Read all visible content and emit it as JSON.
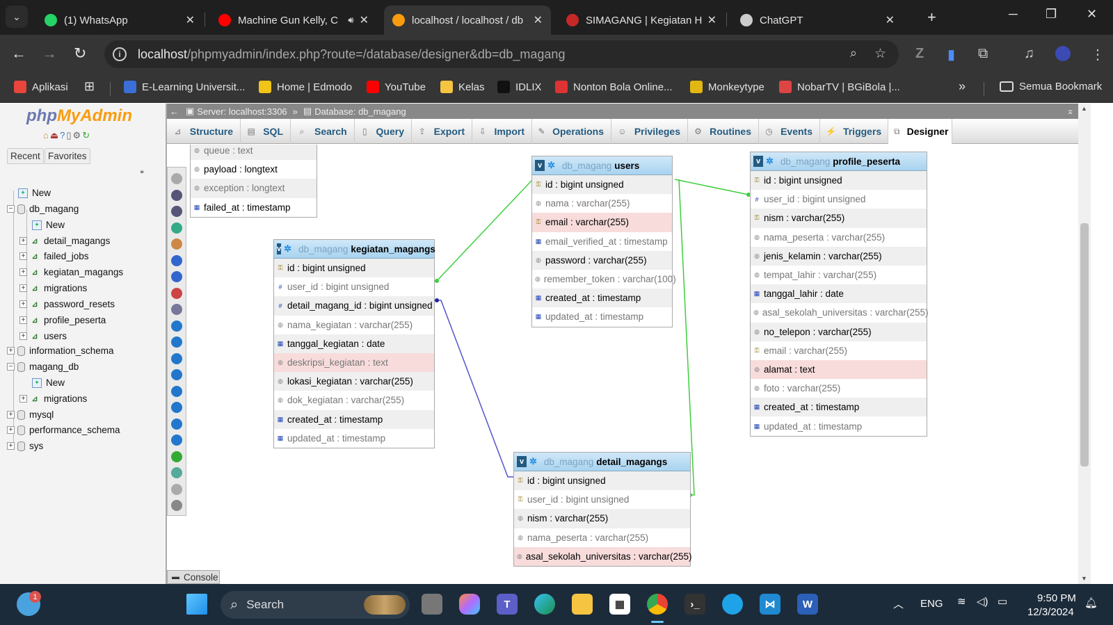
{
  "browser": {
    "tabs": [
      {
        "title": "(1) WhatsApp",
        "icon": "whatsapp-icon",
        "color": "#25d366"
      },
      {
        "title": "Machine Gun Kelly, C",
        "icon": "youtube-icon",
        "color": "#ff0000"
      },
      {
        "title": "localhost / localhost / db",
        "icon": "phpmyadmin-icon",
        "color": "#f89c0e"
      },
      {
        "title": "SIMAGANG | Kegiatan Ha",
        "icon": "shield-icon",
        "color": "#c62828"
      },
      {
        "title": "ChatGPT",
        "icon": "chatgpt-icon",
        "color": "#cccccc"
      }
    ],
    "url_host": "localhost",
    "url_path": "/phpmyadmin/index.php?route=/database/designer&db=db_magang",
    "bookmarks": [
      {
        "label": "Aplikasi",
        "icon": "apps-grid-icon"
      },
      {
        "label": "E-Learning Universit...",
        "icon": "university-icon"
      },
      {
        "label": "Home | Edmodo",
        "icon": "edmodo-icon"
      },
      {
        "label": "YouTube",
        "icon": "youtube-icon"
      },
      {
        "label": "Kelas",
        "icon": "classroom-icon"
      },
      {
        "label": "IDLIX",
        "icon": "idlix-icon"
      },
      {
        "label": "Nonton Bola Online...",
        "icon": "ball-icon"
      },
      {
        "label": "Monkeytype",
        "icon": "monkeytype-icon"
      },
      {
        "label": "NobarTV | BGiBola |...",
        "icon": "nobartv-icon"
      }
    ],
    "all_bookmarks": "Semua Bookmark",
    "overflow": "»"
  },
  "pma": {
    "logo_php": "php",
    "logo_admin": "MyAdmin",
    "left_tabs": [
      "Recent",
      "Favorites"
    ],
    "tree": [
      {
        "label": "New",
        "kind": "new"
      },
      {
        "label": "db_magang",
        "kind": "db",
        "exp": "−"
      },
      {
        "label": "New",
        "kind": "new"
      },
      {
        "label": "detail_magangs",
        "kind": "tbl"
      },
      {
        "label": "failed_jobs",
        "kind": "tbl"
      },
      {
        "label": "kegiatan_magangs",
        "kind": "tbl"
      },
      {
        "label": "migrations",
        "kind": "tbl"
      },
      {
        "label": "password_resets",
        "kind": "tbl"
      },
      {
        "label": "profile_peserta",
        "kind": "tbl"
      },
      {
        "label": "users",
        "kind": "tbl"
      },
      {
        "label": "information_schema",
        "kind": "db",
        "exp": "+"
      },
      {
        "label": "magang_db",
        "kind": "db",
        "exp": "−"
      },
      {
        "label": "New",
        "kind": "new"
      },
      {
        "label": "migrations",
        "kind": "tbl"
      },
      {
        "label": "mysql",
        "kind": "db",
        "exp": "+"
      },
      {
        "label": "performance_schema",
        "kind": "db",
        "exp": "+"
      },
      {
        "label": "sys",
        "kind": "db",
        "exp": "+"
      }
    ],
    "breadcrumb_server": "Server: localhost:3306",
    "breadcrumb_db": "Database: db_magang",
    "menu": [
      "Structure",
      "SQL",
      "Search",
      "Query",
      "Export",
      "Import",
      "Operations",
      "Privileges",
      "Routines",
      "Events",
      "Triggers",
      "Designer"
    ],
    "active_menu": "Designer",
    "console": "Console"
  },
  "designer": {
    "failed_jobs_partial": [
      {
        "text": "queue : text",
        "nn": true
      },
      {
        "text": "payload : longtext",
        "nn": false
      },
      {
        "text": "exception : longtext",
        "nn": true
      },
      {
        "text": "failed_at : timestamp",
        "nn": false
      }
    ],
    "users": {
      "db": "db_magang",
      "name": "users",
      "cols": [
        {
          "text": "id : bigint unsigned",
          "nn": false,
          "k": "key"
        },
        {
          "text": "nama : varchar(255)",
          "nn": true,
          "k": "txt"
        },
        {
          "text": "email : varchar(255)",
          "nn": false,
          "k": "key",
          "hl": true
        },
        {
          "text": "email_verified_at : timestamp",
          "nn": true,
          "k": "dt"
        },
        {
          "text": "password : varchar(255)",
          "nn": false,
          "k": "txt"
        },
        {
          "text": "remember_token : varchar(100)",
          "nn": true,
          "k": "txt"
        },
        {
          "text": "created_at : timestamp",
          "nn": false,
          "k": "dt"
        },
        {
          "text": "updated_at : timestamp",
          "nn": true,
          "k": "dt"
        }
      ]
    },
    "kegiatan_magangs": {
      "db": "db_magang",
      "name": "kegiatan_magangs",
      "cols": [
        {
          "text": "id : bigint unsigned",
          "nn": false,
          "k": "key"
        },
        {
          "text": "user_id : bigint unsigned",
          "nn": true,
          "k": "num"
        },
        {
          "text": "detail_magang_id : bigint unsigned",
          "nn": false,
          "k": "num"
        },
        {
          "text": "nama_kegiatan : varchar(255)",
          "nn": true,
          "k": "txt"
        },
        {
          "text": "tanggal_kegiatan : date",
          "nn": false,
          "k": "dt"
        },
        {
          "text": "deskripsi_kegiatan : text",
          "nn": true,
          "k": "txt",
          "hl": true
        },
        {
          "text": "lokasi_kegiatan : varchar(255)",
          "nn": false,
          "k": "txt"
        },
        {
          "text": "dok_kegiatan : varchar(255)",
          "nn": true,
          "k": "txt"
        },
        {
          "text": "created_at : timestamp",
          "nn": false,
          "k": "dt"
        },
        {
          "text": "updated_at : timestamp",
          "nn": true,
          "k": "dt"
        }
      ]
    },
    "profile_peserta": {
      "db": "db_magang",
      "name": "profile_peserta",
      "cols": [
        {
          "text": "id : bigint unsigned",
          "nn": false,
          "k": "key"
        },
        {
          "text": "user_id : bigint unsigned",
          "nn": true,
          "k": "num"
        },
        {
          "text": "nism : varchar(255)",
          "nn": false,
          "k": "key"
        },
        {
          "text": "nama_peserta : varchar(255)",
          "nn": true,
          "k": "txt"
        },
        {
          "text": "jenis_kelamin : varchar(255)",
          "nn": false,
          "k": "txt"
        },
        {
          "text": "tempat_lahir : varchar(255)",
          "nn": true,
          "k": "txt"
        },
        {
          "text": "tanggal_lahir : date",
          "nn": false,
          "k": "dt"
        },
        {
          "text": "asal_sekolah_universitas : varchar(255)",
          "nn": true,
          "k": "txt"
        },
        {
          "text": "no_telepon : varchar(255)",
          "nn": false,
          "k": "txt"
        },
        {
          "text": "email : varchar(255)",
          "nn": true,
          "k": "key"
        },
        {
          "text": "alamat : text",
          "nn": false,
          "k": "txt",
          "hl": true
        },
        {
          "text": "foto : varchar(255)",
          "nn": true,
          "k": "txt"
        },
        {
          "text": "created_at : timestamp",
          "nn": false,
          "k": "dt"
        },
        {
          "text": "updated_at : timestamp",
          "nn": true,
          "k": "dt"
        }
      ]
    },
    "detail_magangs": {
      "db": "db_magang",
      "name": "detail_magangs",
      "cols": [
        {
          "text": "id : bigint unsigned",
          "nn": false,
          "k": "key"
        },
        {
          "text": "user_id : bigint unsigned",
          "nn": true,
          "k": "key"
        },
        {
          "text": "nism : varchar(255)",
          "nn": false,
          "k": "txt"
        },
        {
          "text": "nama_peserta : varchar(255)",
          "nn": true,
          "k": "txt"
        },
        {
          "text": "asal_sekolah_universitas : varchar(255)",
          "nn": false,
          "k": "txt",
          "hl": true
        }
      ]
    }
  },
  "taskbar": {
    "search": "Search",
    "lang": "ENG",
    "time": "9:50 PM",
    "date": "12/3/2024",
    "notif_count": "1"
  },
  "colors": {
    "relation_green": "#3ccf3c",
    "relation_blue": "#5555cc",
    "pma_link": "#235a81"
  }
}
